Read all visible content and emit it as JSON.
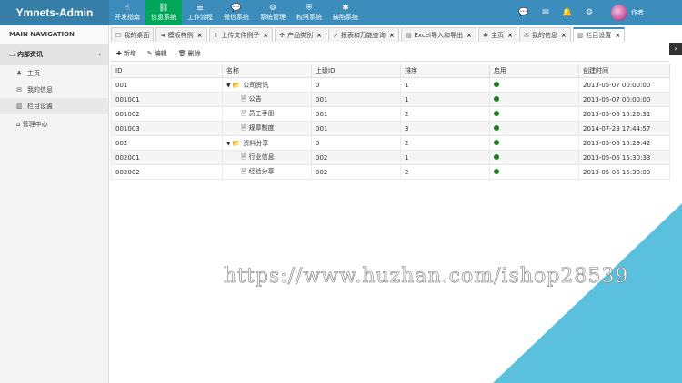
{
  "app": {
    "title": "Ymnets-Admin"
  },
  "topnav": [
    {
      "icon": "hand-icon",
      "glyph": "☝",
      "label": "开发指南",
      "active": false
    },
    {
      "icon": "sitemap-icon",
      "glyph": "⛓",
      "label": "信息系统",
      "active": true
    },
    {
      "icon": "flow-icon",
      "glyph": "≣",
      "label": "工作流程",
      "active": false
    },
    {
      "icon": "chat-icon",
      "glyph": "💬",
      "label": "微信系统",
      "active": false
    },
    {
      "icon": "gears-icon",
      "glyph": "⚙",
      "label": "系统管理",
      "active": false
    },
    {
      "icon": "shield-icon",
      "glyph": "⛨",
      "label": "权限系统",
      "active": false
    },
    {
      "icon": "bug-icon",
      "glyph": "✱",
      "label": "缺陷系统",
      "active": false
    }
  ],
  "topright": {
    "user": "作者"
  },
  "sidebar": {
    "header": "MAIN NAVIGATION",
    "group": "内部资讯",
    "items": [
      {
        "icon": "tree-icon",
        "glyph": "♣",
        "label": "主页",
        "active": false
      },
      {
        "icon": "envelope-icon",
        "glyph": "✉",
        "label": "我的信息",
        "active": false
      },
      {
        "icon": "columns-icon",
        "glyph": "▥",
        "label": "栏目设置",
        "active": true
      }
    ],
    "top_item": {
      "icon": "bank-icon",
      "glyph": "⌂",
      "label": "管理中心"
    }
  },
  "tabs": [
    {
      "icon": "chat-icon",
      "glyph": "☐",
      "label": "我的桌面",
      "closable": false,
      "active": false
    },
    {
      "icon": "bullhorn-icon",
      "glyph": "◄",
      "label": "模板样例",
      "closable": true,
      "active": false
    },
    {
      "icon": "upload-icon",
      "glyph": "⬆",
      "label": "上传文件例子",
      "closable": true,
      "active": false
    },
    {
      "icon": "puzzle-icon",
      "glyph": "✣",
      "label": "产品类别",
      "closable": true,
      "active": false
    },
    {
      "icon": "chart-line-icon",
      "glyph": "↗",
      "label": "报表和万能查询",
      "closable": true,
      "active": false
    },
    {
      "icon": "file-excel-icon",
      "glyph": "▤",
      "label": "Excel导入和导出",
      "closable": true,
      "active": false
    },
    {
      "icon": "home-icon",
      "glyph": "♣",
      "label": "主页",
      "closable": true,
      "active": false
    },
    {
      "icon": "envelope-icon",
      "glyph": "✉",
      "label": "我的信息",
      "closable": true,
      "active": false
    },
    {
      "icon": "columns-icon",
      "glyph": "▥",
      "label": "栏目设置",
      "closable": true,
      "active": true
    }
  ],
  "toolbar": {
    "add": "新增",
    "edit": "编辑",
    "delete": "删除"
  },
  "grid": {
    "headers": [
      "ID",
      "名称",
      "上级ID",
      "排序",
      "启用",
      "创建时间"
    ],
    "rows": [
      {
        "id": "001",
        "name": "公司资讯",
        "level": 0,
        "folder": true,
        "parent": "0",
        "sort": "1",
        "enabled": true,
        "created": "2013-05-07 00:00:00"
      },
      {
        "id": "001001",
        "name": "公告",
        "level": 1,
        "folder": false,
        "parent": "001",
        "sort": "1",
        "enabled": true,
        "created": "2013-05-07 00:00:00"
      },
      {
        "id": "001002",
        "name": "员工手册",
        "level": 1,
        "folder": false,
        "parent": "001",
        "sort": "2",
        "enabled": true,
        "created": "2013-05-06 15:26:31"
      },
      {
        "id": "001003",
        "name": "规章制度",
        "level": 1,
        "folder": false,
        "parent": "001",
        "sort": "3",
        "enabled": true,
        "created": "2014-07-23 17:44:57"
      },
      {
        "id": "002",
        "name": "资料分享",
        "level": 0,
        "folder": true,
        "parent": "0",
        "sort": "2",
        "enabled": true,
        "created": "2013-05-06 15:29:42"
      },
      {
        "id": "002001",
        "name": "行业信息",
        "level": 1,
        "folder": false,
        "parent": "002",
        "sort": "1",
        "enabled": true,
        "created": "2013-05-06 15:30:33"
      },
      {
        "id": "002002",
        "name": "经验分享",
        "level": 1,
        "folder": false,
        "parent": "002",
        "sort": "2",
        "enabled": true,
        "created": "2013-05-06 15:33:09"
      }
    ]
  },
  "watermark": "https://www.huzhan.com/ishop28539",
  "colors": {
    "header": "#3c8dbc",
    "logo_bg": "#367fa9",
    "active_nav": "#00a65a",
    "enabled_dot": "#1b7a1b",
    "corner": "#5bc0de"
  }
}
